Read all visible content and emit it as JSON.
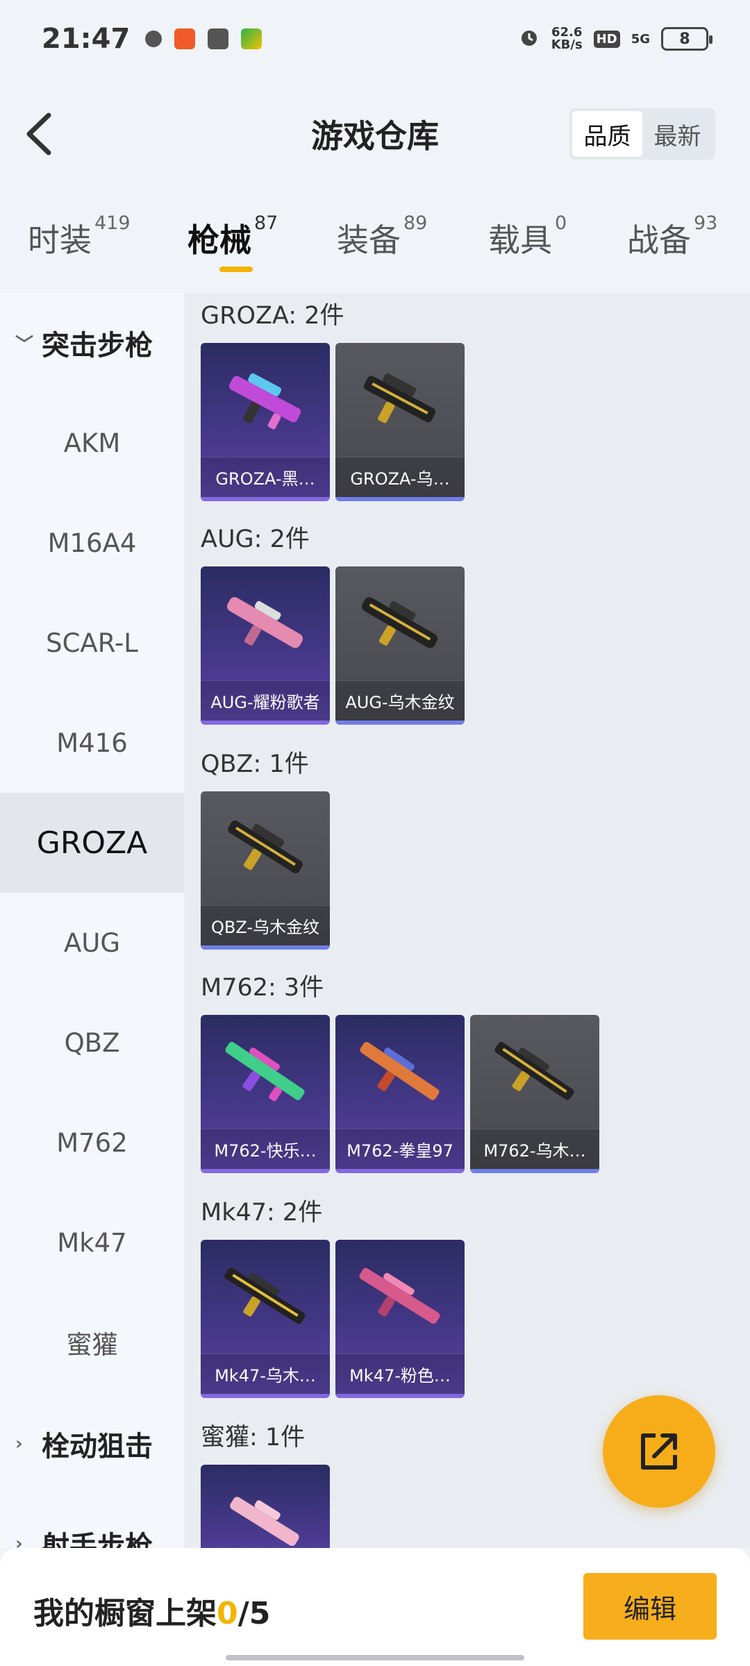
{
  "status_bar": {
    "time": "21:47",
    "net_speed": "62.6",
    "net_unit": "KB/s",
    "hd": "HD",
    "signal": "5G",
    "battery": "8"
  },
  "header": {
    "title": "游戏仓库",
    "sort_quality": "品质",
    "sort_newest": "最新"
  },
  "tabs": [
    {
      "label": "时装",
      "count": "419"
    },
    {
      "label": "枪械",
      "count": "87"
    },
    {
      "label": "装备",
      "count": "89"
    },
    {
      "label": "载具",
      "count": "0"
    },
    {
      "label": "战备",
      "count": "93"
    }
  ],
  "sidebar": {
    "group_assault": "突击步枪",
    "items": [
      "AKM",
      "M16A4",
      "SCAR-L",
      "M416",
      "GROZA",
      "AUG",
      "QBZ",
      "M762",
      "Mk47",
      "蜜獾"
    ],
    "group_bolt": "栓动狙击",
    "group_marksman": "射手步枪"
  },
  "sections": [
    {
      "title": "GROZA: 2件",
      "items": [
        "GROZA-黑…",
        "GROZA-乌…"
      ]
    },
    {
      "title": "AUG: 2件",
      "items": [
        "AUG-耀粉歌者",
        "AUG-乌木金纹"
      ]
    },
    {
      "title": "QBZ: 1件",
      "items": [
        "QBZ-乌木金纹"
      ]
    },
    {
      "title": "M762: 3件",
      "items": [
        "M762-快乐…",
        "M762-拳皇97",
        "M762-乌木…"
      ]
    },
    {
      "title": "Mk47: 2件",
      "items": [
        "Mk47-乌木…",
        "Mk47-粉色…"
      ]
    },
    {
      "title": "蜜獾: 1件",
      "items": []
    }
  ],
  "bottom": {
    "showcase_label": "我的橱窗上架",
    "showcase_count": "0",
    "showcase_total": "/5",
    "edit": "编辑"
  },
  "colors": {
    "accent": "#f7ae1c",
    "purple_card": "#4a3a8f",
    "gray_card": "#4f5056"
  }
}
